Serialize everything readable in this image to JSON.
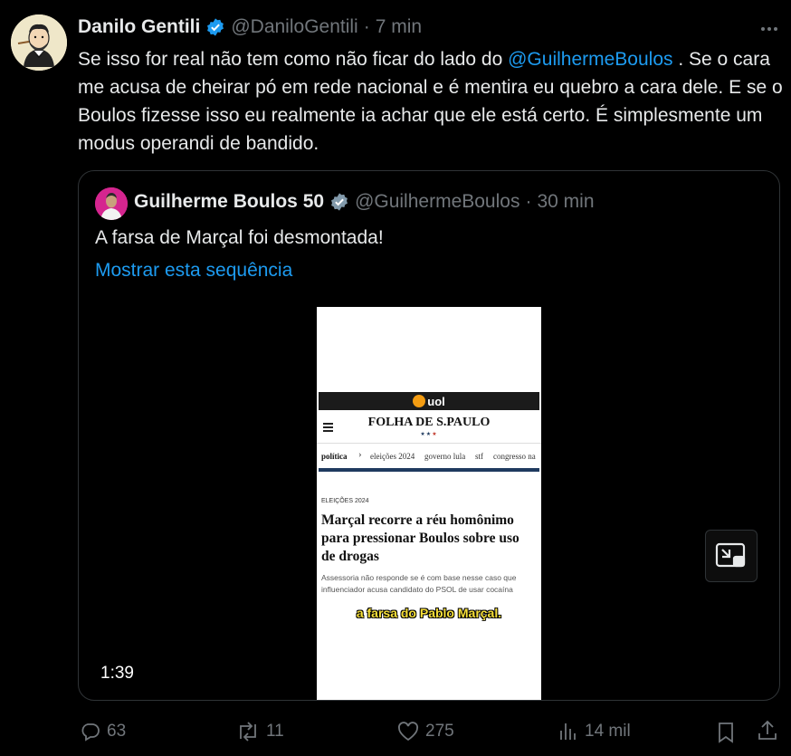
{
  "tweet": {
    "author": {
      "name": "Danilo Gentili",
      "handle": "@DaniloGentili"
    },
    "separator": "·",
    "time": "7 min",
    "text_before": "Se isso for real não tem como não ficar do lado do ",
    "mention": "@GuilhermeBoulos",
    "text_after": " . Se o cara me acusa de cheirar pó em rede nacional e é mentira eu quebro a cara dele. E se o Boulos fizesse isso eu realmente ia achar que ele está certo. É simplesmente um modus operandi de bandido."
  },
  "quote": {
    "author": {
      "name": "Guilherme Boulos 50",
      "handle": "@GuilhermeBoulos"
    },
    "separator": "·",
    "time": "30 min",
    "text": "A farsa de Marçal foi desmontada!",
    "show_thread": "Mostrar esta sequência",
    "video": {
      "duration": "1:39",
      "frame": {
        "uol": "uol",
        "masthead": "FOLHA DE S.PAULO",
        "nav": [
          "política",
          "eleições 2024",
          "governo lula",
          "stf",
          "congresso na"
        ],
        "kicker": "ELEIÇÕES 2024",
        "headline": "Marçal recorre a réu homônimo para pressionar Boulos sobre uso de drogas",
        "subheadline": "Assessoria não responde se é com base nesse caso que influenciador acusa candidato do PSOL de usar cocaína",
        "caption": "a farsa do Pablo Marçal."
      }
    }
  },
  "actions": {
    "replies": "63",
    "retweets": "11",
    "likes": "275",
    "views": "14 mil"
  },
  "colors": {
    "accent": "#1d9bf0",
    "muted": "#71767b",
    "text": "#e7e9ea",
    "border": "#2f3336"
  },
  "icons": [
    "verified-badge-icon",
    "more-icon",
    "picture-in-picture-icon",
    "reply-icon",
    "retweet-icon",
    "like-icon",
    "views-icon",
    "bookmark-icon",
    "share-icon"
  ]
}
